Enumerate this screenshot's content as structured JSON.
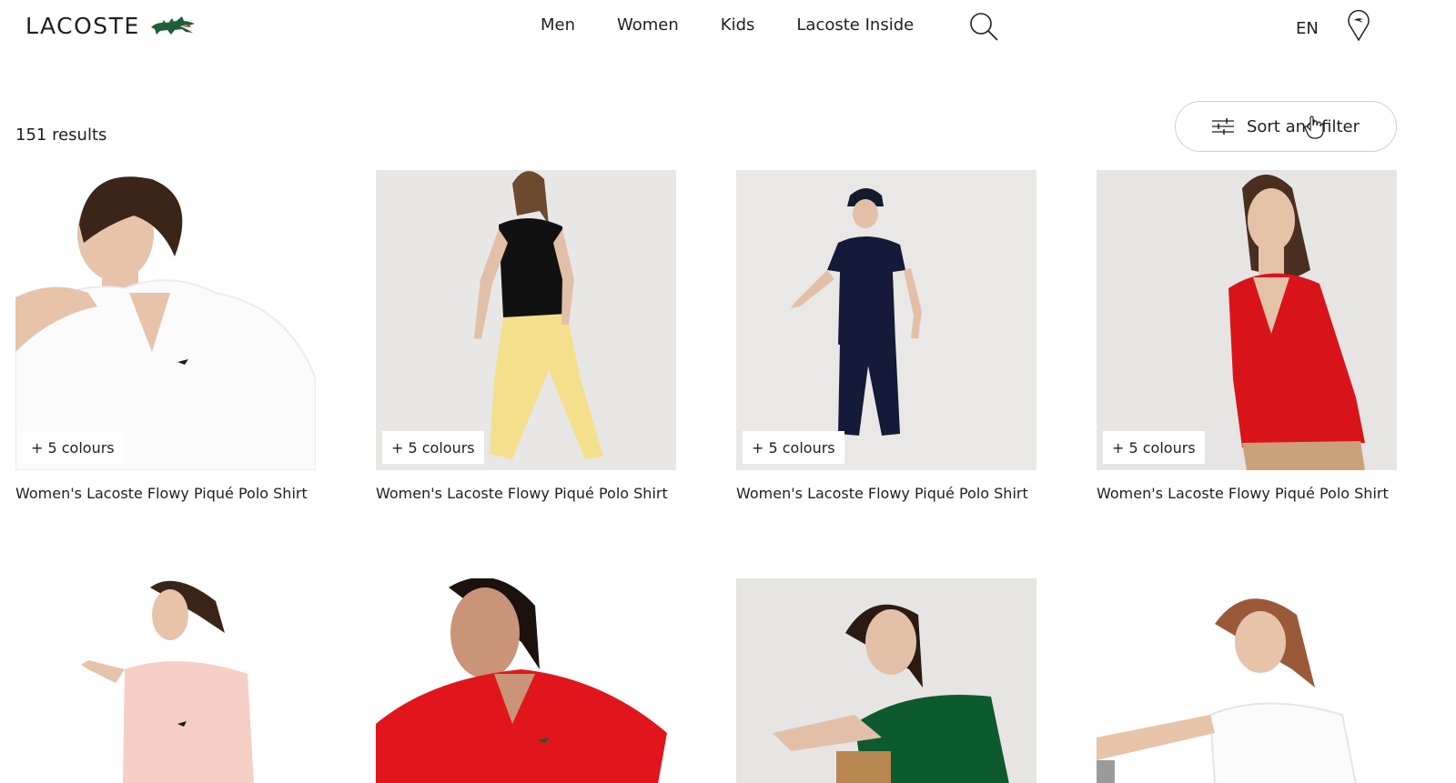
{
  "header": {
    "logo_text": "LACOSTE",
    "nav": [
      "Men",
      "Women",
      "Kids",
      "Lacoste Inside"
    ],
    "language": "EN"
  },
  "listing": {
    "results_count": "151 results",
    "sort_filter_label": "Sort and filter"
  },
  "products": [
    {
      "colours": "+ 5 colours",
      "name": "Women's Lacoste Flowy Piqué Polo Shirt",
      "shirt_color": "#ffffff"
    },
    {
      "colours": "+ 5 colours",
      "name": "Women's Lacoste Flowy Piqué Polo Shirt",
      "shirt_color": "#111111"
    },
    {
      "colours": "+ 5 colours",
      "name": "Women's Lacoste Flowy Piqué Polo Shirt",
      "shirt_color": "#141a38"
    },
    {
      "colours": "+ 5 colours",
      "name": "Women's Lacoste Flowy Piqué Polo Shirt",
      "shirt_color": "#d8141a"
    },
    {
      "shirt_color": "#f6cfc4"
    },
    {
      "shirt_color": "#e0161c"
    },
    {
      "shirt_color": "#0d5a2e"
    },
    {
      "shirt_color": "#ffffff"
    }
  ],
  "colors": {
    "brand_green": "#1e5e36",
    "text": "#1f1f1f",
    "border": "#cfcfcf"
  }
}
